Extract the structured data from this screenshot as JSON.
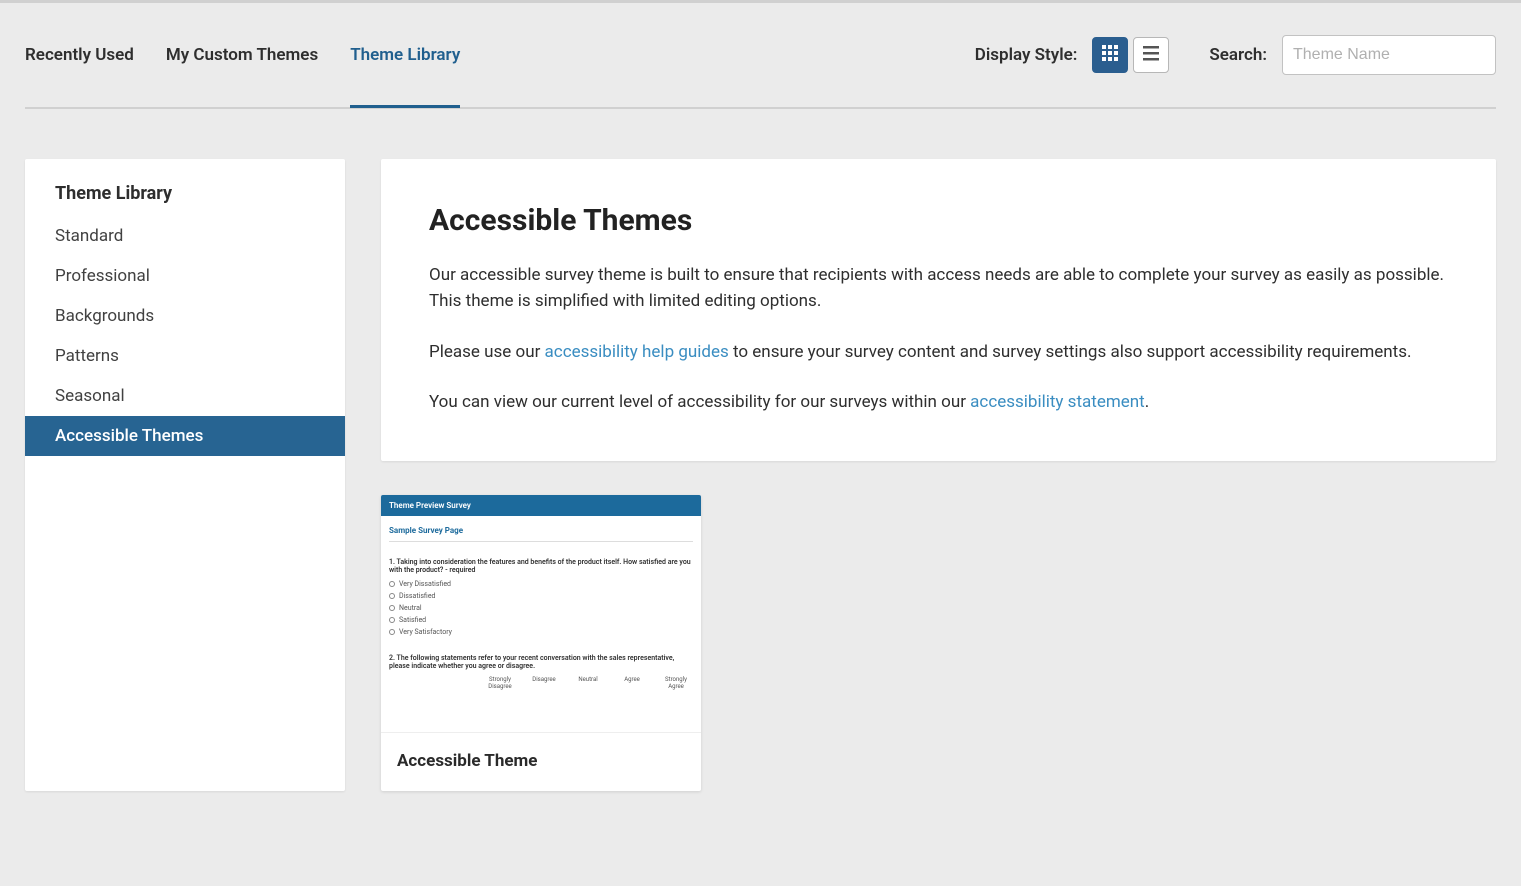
{
  "tabs": {
    "recently_used": "Recently Used",
    "my_custom": "My Custom Themes",
    "theme_library": "Theme Library"
  },
  "display_label": "Display Style:",
  "search_label": "Search:",
  "search_placeholder": "Theme Name",
  "sidebar": {
    "title": "Theme Library",
    "items": [
      "Standard",
      "Professional",
      "Backgrounds",
      "Patterns",
      "Seasonal",
      "Accessible Themes"
    ]
  },
  "info": {
    "title": "Accessible Themes",
    "p1": "Our accessible survey theme is built to ensure that recipients with access needs are able to complete your survey as easily as possible. This theme is simplified with limited editing options.",
    "p2a": "Please use our ",
    "p2link": "accessibility help guides",
    "p2b": " to ensure your survey content and survey settings also support accessibility requirements.",
    "p3a": "You can view our current level of accessibility for our surveys within our ",
    "p3link": "accessibility statement",
    "p3b": "."
  },
  "theme_card": {
    "title": "Accessible Theme",
    "preview": {
      "header": "Theme Preview Survey",
      "page_title": "Sample Survey Page",
      "q1": "1. Taking into consideration the features and benefits of the product itself. How satisfied are you with the product? - required",
      "opts": [
        "Very Dissatisfied",
        "Dissatisfied",
        "Neutral",
        "Satisfied",
        "Very Satisfactory"
      ],
      "q2": "2. The following statements refer to your recent conversation with the sales representative, please indicate whether you agree or disagree.",
      "likert": [
        "Strongly Disagree",
        "Disagree",
        "Neutral",
        "Agree",
        "Strongly Agree"
      ]
    }
  }
}
